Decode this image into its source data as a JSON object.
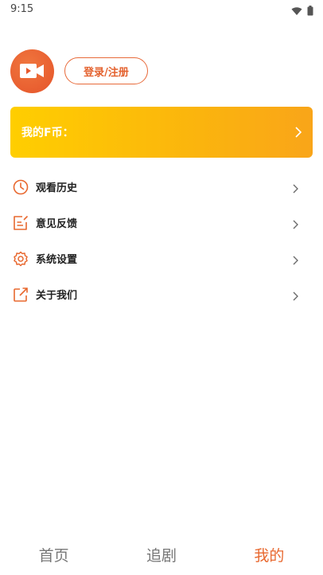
{
  "status_bar": {
    "time": "9:15",
    "icons": [
      "wifi-icon",
      "battery-icon"
    ]
  },
  "profile": {
    "avatar_icon": "video-camera-icon",
    "login_label": "登录/注册"
  },
  "coin_card": {
    "label": "我的F币："
  },
  "menu": {
    "items": [
      {
        "label": "观看历史",
        "icon": "clock-icon"
      },
      {
        "label": "意见反馈",
        "icon": "feedback-icon"
      },
      {
        "label": "系统设置",
        "icon": "gear-icon"
      },
      {
        "label": "关于我们",
        "icon": "external-link-icon"
      }
    ]
  },
  "bottom_nav": {
    "tabs": [
      {
        "label": "首页",
        "active": false
      },
      {
        "label": "追剧",
        "active": false
      },
      {
        "label": "我的",
        "active": true
      }
    ]
  },
  "colors": {
    "accent": "#e8682f",
    "coin_gradient_start": "#ffce00",
    "coin_gradient_end": "#f9a519"
  }
}
